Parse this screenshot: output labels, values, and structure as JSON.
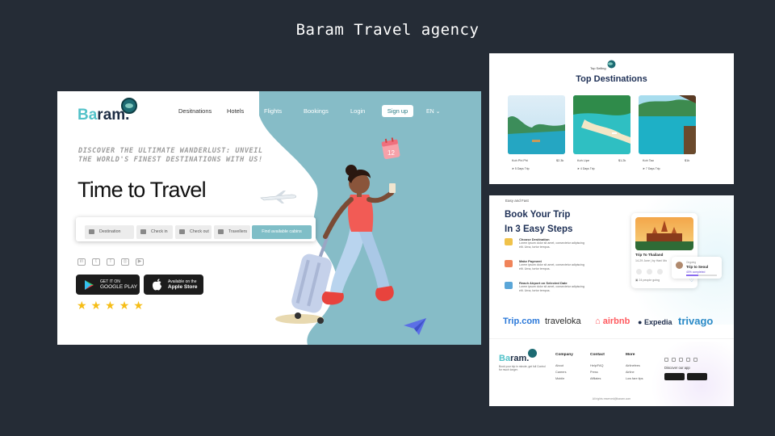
{
  "page": {
    "title": "Baram Travel agency"
  },
  "hero": {
    "logo": {
      "main": "Ba",
      "rest": "ram."
    },
    "nav": [
      "Desitnations",
      "Hotels",
      "Flights",
      "Bookings",
      "Login"
    ],
    "signup_label": "Sign up",
    "lang": "EN ⌄",
    "tagline": "Discover the ultimate wanderlust: unveil the world's finest destinations with us!",
    "headline": "Time to Travel",
    "search": {
      "fields": [
        "Destination",
        "Check in",
        "Check out",
        "Travellers"
      ],
      "button": "Find available cabins"
    },
    "socials": [
      "in",
      "t",
      "f",
      "◎",
      "▶"
    ],
    "google_play": {
      "small": "GET IT ON",
      "big": "GOOGLE PLAY"
    },
    "app_store": {
      "small": "Available on the",
      "big": "Apple Store"
    },
    "rating_stars": 5,
    "calendar_badge": "12"
  },
  "destinations": {
    "subtitle": "Top Selling",
    "title": "Top Destinations",
    "cards": [
      {
        "name": "Koh Phi Phi",
        "price": "$2.3k",
        "trip": "5 Days Trip"
      },
      {
        "name": "Koh Lipe",
        "price": "$1.2k",
        "trip": "4 Days Trip"
      },
      {
        "name": "Koh Tao",
        "price": "$1k",
        "trip": "7 Days Trip"
      }
    ]
  },
  "book": {
    "eyebrow": "Easy and Fast",
    "title_line1": "Book Your Trip",
    "title_line2": "In 3 Easy Steps",
    "steps": [
      {
        "heading": "Choose Destination",
        "text": "Lorem ipsum dolor sit amet, consectetur adipiscing elit. Urna, tortor tempus."
      },
      {
        "heading": "Make Payment",
        "text": "Lorem ipsum dolor sit amet, consectetur adipiscing elit. Urna, tortor tempus."
      },
      {
        "heading": "Reach Airport on Selected Date",
        "text": "Lorem ipsum dolor sit amet, consectetur adipiscing elit. Urna, tortor tempus."
      }
    ],
    "trip_card": {
      "name": "Trip To Thailand",
      "by": "14-29 June | by Hani Mo",
      "going": "24 people going"
    },
    "ongoing": {
      "label": "Ongoing",
      "trip": "Trip to Seoul",
      "progress_text": "40% completed",
      "progress": 0.4
    },
    "partners": [
      {
        "name": "Trip.com",
        "color": "#2a78d9"
      },
      {
        "name": "traveloka",
        "color": "#2b2b2b"
      },
      {
        "name": "airbnb",
        "color": "#ff5a5f"
      },
      {
        "name": "Expedia",
        "color": "#1d2c4b"
      },
      {
        "name": "trivago",
        "color": "#2b8ac7"
      }
    ],
    "footer": {
      "logo_main": "Ba",
      "logo_rest": "ram.",
      "desc": "Book your trip in minute, get full Control for much longer.",
      "columns": [
        {
          "heading": "Company",
          "links": [
            "About",
            "Careers",
            "Mobile"
          ]
        },
        {
          "heading": "Contact",
          "links": [
            "Help/FAQ",
            "Press",
            "Affilates"
          ]
        },
        {
          "heading": "More",
          "links": [
            "Airlinefees",
            "Airline",
            "Low fare tips"
          ]
        }
      ],
      "discover": "Discover our app",
      "copyright": "All rights reserved@baram.com"
    }
  }
}
